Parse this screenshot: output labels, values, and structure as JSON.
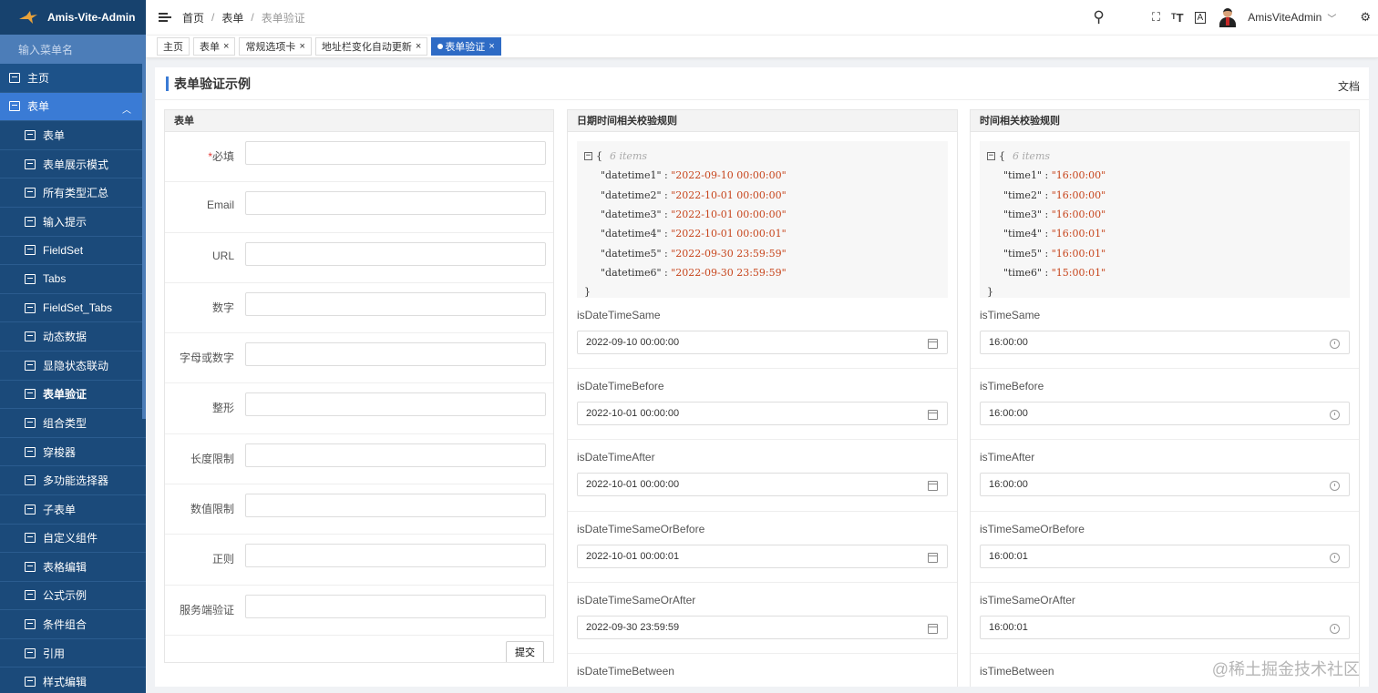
{
  "app": {
    "title": "Amis-Vite-Admin"
  },
  "sidebar": {
    "search_placeholder": "输入菜单名",
    "top_items": [
      {
        "label": "主页"
      }
    ],
    "parent": {
      "label": "表单"
    },
    "items": [
      {
        "label": "表单"
      },
      {
        "label": "表单展示模式"
      },
      {
        "label": "所有类型汇总"
      },
      {
        "label": "输入提示"
      },
      {
        "label": "FieldSet"
      },
      {
        "label": "Tabs"
      },
      {
        "label": "FieldSet_Tabs"
      },
      {
        "label": "动态数据"
      },
      {
        "label": "显隐状态联动"
      },
      {
        "label": "表单验证"
      },
      {
        "label": "组合类型"
      },
      {
        "label": "穿梭器"
      },
      {
        "label": "多功能选择器"
      },
      {
        "label": "子表单"
      },
      {
        "label": "自定义组件"
      },
      {
        "label": "表格编辑"
      },
      {
        "label": "公式示例"
      },
      {
        "label": "条件组合"
      },
      {
        "label": "引用"
      },
      {
        "label": "样式编辑"
      }
    ]
  },
  "header": {
    "breadcrumb": [
      "首页",
      "表单",
      "表单验证"
    ],
    "user_name": "AmisViteAdmin"
  },
  "tabs": [
    {
      "label": "主页",
      "closable": false
    },
    {
      "label": "表单",
      "closable": true
    },
    {
      "label": "常规选项卡",
      "closable": true
    },
    {
      "label": "地址栏变化自动更新",
      "closable": true
    },
    {
      "label": "表单验证",
      "closable": true
    }
  ],
  "page": {
    "title": "表单验证示例",
    "doc_link": "文档"
  },
  "form_panel": {
    "title": "表单",
    "fields": [
      {
        "label": "必填",
        "required": true
      },
      {
        "label": "Email"
      },
      {
        "label": "URL"
      },
      {
        "label": "数字"
      },
      {
        "label": "字母或数字"
      },
      {
        "label": "整形"
      },
      {
        "label": "长度限制"
      },
      {
        "label": "数值限制"
      },
      {
        "label": "正则"
      },
      {
        "label": "服务端验证"
      }
    ],
    "submit_label": "提交"
  },
  "datetime_panel": {
    "title": "日期时间相关校验规则",
    "json_meta": "6 items",
    "json": [
      {
        "key": "\"datetime1\"",
        "value": "\"2022-09-10 00:00:00\""
      },
      {
        "key": "\"datetime2\"",
        "value": "\"2022-10-01 00:00:00\""
      },
      {
        "key": "\"datetime3\"",
        "value": "\"2022-10-01 00:00:00\""
      },
      {
        "key": "\"datetime4\"",
        "value": "\"2022-10-01 00:00:01\""
      },
      {
        "key": "\"datetime5\"",
        "value": "\"2022-09-30 23:59:59\""
      },
      {
        "key": "\"datetime6\"",
        "value": "\"2022-09-30 23:59:59\""
      }
    ],
    "fields": [
      {
        "label": "isDateTimeSame",
        "value": "2022-09-10 00:00:00"
      },
      {
        "label": "isDateTimeBefore",
        "value": "2022-10-01 00:00:00"
      },
      {
        "label": "isDateTimeAfter",
        "value": "2022-10-01 00:00:00"
      },
      {
        "label": "isDateTimeSameOrBefore",
        "value": "2022-10-01 00:00:01"
      },
      {
        "label": "isDateTimeSameOrAfter",
        "value": "2022-09-30 23:59:59"
      },
      {
        "label": "isDateTimeBetween",
        "value": ""
      }
    ]
  },
  "time_panel": {
    "title": "时间相关校验规则",
    "json_meta": "6 items",
    "json": [
      {
        "key": "\"time1\"",
        "value": "\"16:00:00\""
      },
      {
        "key": "\"time2\"",
        "value": "\"16:00:00\""
      },
      {
        "key": "\"time3\"",
        "value": "\"16:00:00\""
      },
      {
        "key": "\"time4\"",
        "value": "\"16:00:01\""
      },
      {
        "key": "\"time5\"",
        "value": "\"16:00:01\""
      },
      {
        "key": "\"time6\"",
        "value": "\"15:00:01\""
      }
    ],
    "fields": [
      {
        "label": "isTimeSame",
        "value": "16:00:00"
      },
      {
        "label": "isTimeBefore",
        "value": "16:00:00"
      },
      {
        "label": "isTimeAfter",
        "value": "16:00:00"
      },
      {
        "label": "isTimeSameOrBefore",
        "value": "16:00:01"
      },
      {
        "label": "isTimeSameOrAfter",
        "value": "16:00:01"
      },
      {
        "label": "isTimeBetween",
        "value": ""
      }
    ]
  },
  "watermark": "@稀土掘金技术社区",
  "colors": {
    "sidebar_bg": "#1b4a7a",
    "sidebar_active": "#3a7bd5",
    "accent": "#2e6bc5",
    "json_value": "#c7451c"
  }
}
